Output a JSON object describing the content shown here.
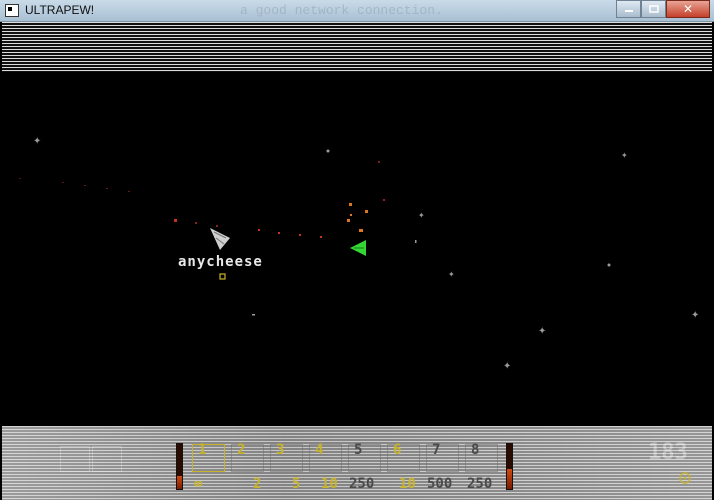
{
  "window": {
    "title": "ULTRAPEW!",
    "ghost_text": "a good network connection.",
    "minimize_icon": "minimize-icon",
    "maximize_icon": "maximize-icon",
    "close_icon": "close-icon"
  },
  "game": {
    "player_name": "anycheese",
    "colors": {
      "player_ship": "#cfcfcf",
      "enemy_ship": "#33d633",
      "particles": "#d23b1f",
      "stars": "#b0b0b0"
    }
  },
  "hud": {
    "health_left": 0.3,
    "health_right": 0.45,
    "score": "183",
    "selected_slot": 1,
    "slots": [
      {
        "num": "1",
        "ammo": "∞",
        "ammo_color": "#c8b42a"
      },
      {
        "num": "2",
        "ammo": "2",
        "ammo_color": "#c8b42a"
      },
      {
        "num": "3",
        "ammo": "5",
        "ammo_color": "#c8b42a"
      },
      {
        "num": "4",
        "ammo": "10",
        "ammo_color": "#c8b42a"
      },
      {
        "num": "5",
        "ammo": "250",
        "ammo_color": "#4a4a4a"
      },
      {
        "num": "6",
        "ammo": "10",
        "ammo_color": "#c8b42a"
      },
      {
        "num": "7",
        "ammo": "500",
        "ammo_color": "#4a4a4a"
      },
      {
        "num": "8",
        "ammo": "250",
        "ammo_color": "#4a4a4a"
      }
    ],
    "slot_num_colors": [
      "#c8b42a",
      "#c8b42a",
      "#c8b42a",
      "#c8b42a",
      "#4a4a4a",
      "#c8b42a",
      "#4a4a4a",
      "#4a4a4a"
    ]
  }
}
